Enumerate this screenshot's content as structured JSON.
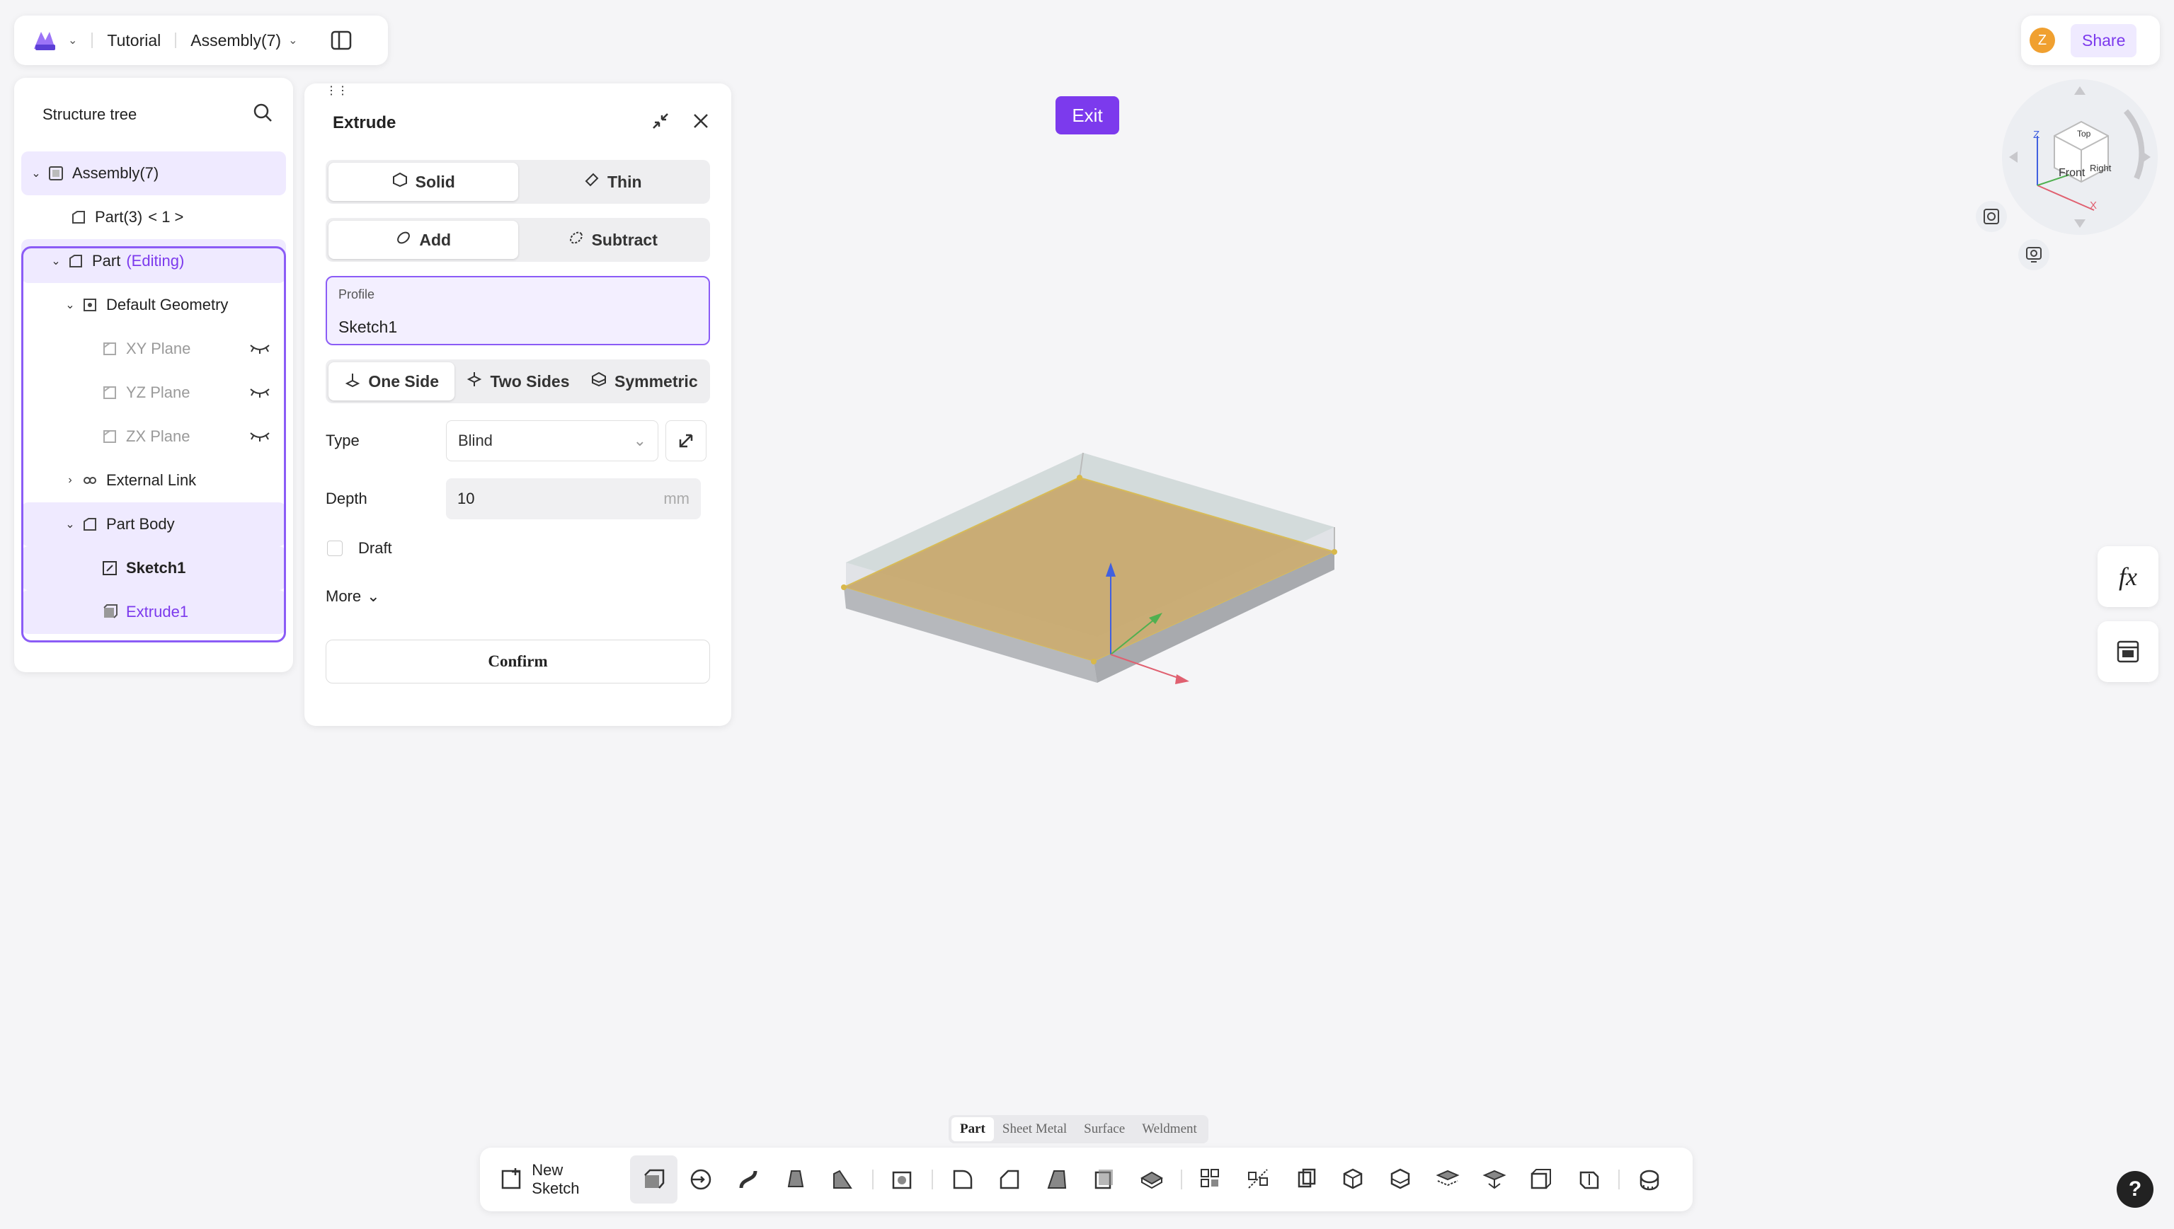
{
  "topbar": {
    "breadcrumb_1": "Tutorial",
    "breadcrumb_2": "Assembly(7)"
  },
  "tree": {
    "title": "Structure tree",
    "items": [
      {
        "label": "Assembly(7)"
      },
      {
        "label": "Part(3)",
        "suffix": "< 1 >"
      },
      {
        "label": "Part",
        "tag": "(Editing)"
      },
      {
        "label": "Default Geometry"
      },
      {
        "label": "XY Plane"
      },
      {
        "label": "YZ Plane"
      },
      {
        "label": "ZX Plane"
      },
      {
        "label": "External Link"
      },
      {
        "label": "Part Body"
      },
      {
        "label": "Sketch1"
      },
      {
        "label": "Extrude1"
      }
    ]
  },
  "extrude": {
    "title": "Extrude",
    "body_type": {
      "solid": "Solid",
      "thin": "Thin",
      "selected": "Solid"
    },
    "operation": {
      "add": "Add",
      "subtract": "Subtract",
      "selected": "Add"
    },
    "profile": {
      "label": "Profile",
      "value": "Sketch1"
    },
    "direction": {
      "one_side": "One Side",
      "two_sides": "Two Sides",
      "symmetric": "Symmetric",
      "selected": "One Side"
    },
    "type": {
      "label": "Type",
      "value": "Blind"
    },
    "depth": {
      "label": "Depth",
      "value": "10",
      "unit": "mm"
    },
    "draft": {
      "label": "Draft",
      "checked": false
    },
    "more": "More",
    "confirm": "Confirm"
  },
  "exit_label": "Exit",
  "user": {
    "initial": "Z",
    "share_label": "Share"
  },
  "viewcube": {
    "top": "Top",
    "front": "Front",
    "right": "Right",
    "axis_z": "Z",
    "axis_x": "X"
  },
  "right_tools": {
    "formula": "fx"
  },
  "modes": {
    "part": "Part",
    "sheet_metal": "Sheet Metal",
    "surface": "Surface",
    "weldment": "Weldment",
    "selected": "Part"
  },
  "toolbar": {
    "new_sketch": "New Sketch"
  },
  "help_label": "?",
  "colors": {
    "accent": "#7c3aed",
    "editing_border": "#8b5cf6",
    "body_fill": "#c8a86a"
  }
}
